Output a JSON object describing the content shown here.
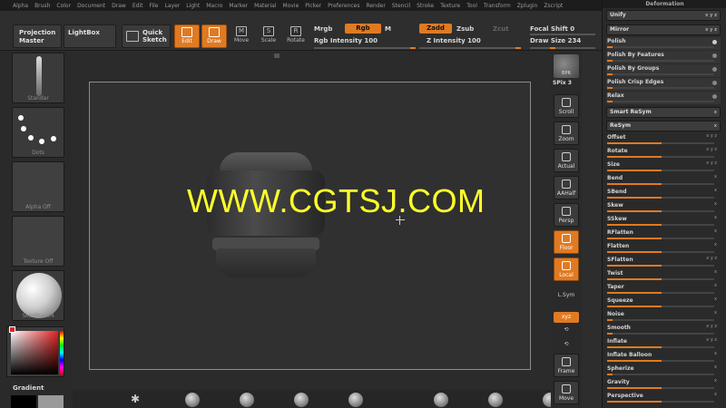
{
  "menu": [
    "Alpha",
    "Brush",
    "Color",
    "Document",
    "Draw",
    "Edit",
    "File",
    "Layer",
    "Light",
    "Macro",
    "Marker",
    "Material",
    "Movie",
    "Picker",
    "Preferences",
    "Render",
    "Stencil",
    "Stroke",
    "Texture",
    "Tool",
    "Transform",
    "Zplugin",
    "Zscript"
  ],
  "toolbar": {
    "projection_master": "Projection Master",
    "lightbox": "LightBox",
    "quick_sketch": "Quick Sketch",
    "edit": "Edit",
    "draw": "Draw",
    "move": "Move",
    "scale": "Scale",
    "rotate": "Rotate",
    "mrgb": "Mrgb",
    "rgb": "Rgb",
    "m": "M",
    "rgb_intensity": "Rgb Intensity 100",
    "zadd": "Zadd",
    "zsub": "Zsub",
    "zcut": "Zcut",
    "z_intensity": "Z Intensity 100",
    "focal_shift": "Focal Shift 0",
    "draw_size": "Draw Size 234",
    "colors": {
      "accent": "#e07a22",
      "bg": "#262626",
      "panel": "#2a2a2a"
    }
  },
  "left": {
    "brush_label": "Standar",
    "stroke_label": "Dots",
    "alpha_label": "Alpha Off",
    "texture_label": "Texture Off",
    "material_label": "SkinShade4",
    "gradient_label": "Gradient"
  },
  "canvas": {
    "watermark": "WWW.CGTSJ.COM"
  },
  "nav": {
    "bpr": "BPR",
    "spix": "SPix 3",
    "scroll": "Scroll",
    "zoom": "Zoom",
    "actual": "Actual",
    "aahalf": "AAHalf",
    "persp": "Persp",
    "floor": "Floor",
    "local": "Local",
    "lsym": "L.Sym",
    "xyz": "xyz",
    "frame": "Frame",
    "move": "Move"
  },
  "deformation": {
    "title": "Deformation",
    "unify": "Unify",
    "mirror": "Mirror",
    "polish": "Polish",
    "polish_features": "Polish By Features",
    "polish_groups": "Polish By Groups",
    "polish_crisp": "Polish Crisp Edges",
    "relax": "Relax",
    "smart_resym": "Smart ReSym",
    "resym": "ReSym",
    "sliders": [
      "Offset",
      "Rotate",
      "Size",
      "Bend",
      "SBend",
      "Skew",
      "SSkew",
      "RFlatten",
      "Flatten",
      "SFlatten",
      "Twist",
      "Taper",
      "Squeeze",
      "Noise",
      "Smooth",
      "Inflate",
      "Inflate Balloon",
      "Spherize",
      "Gravity",
      "Perspective"
    ]
  }
}
